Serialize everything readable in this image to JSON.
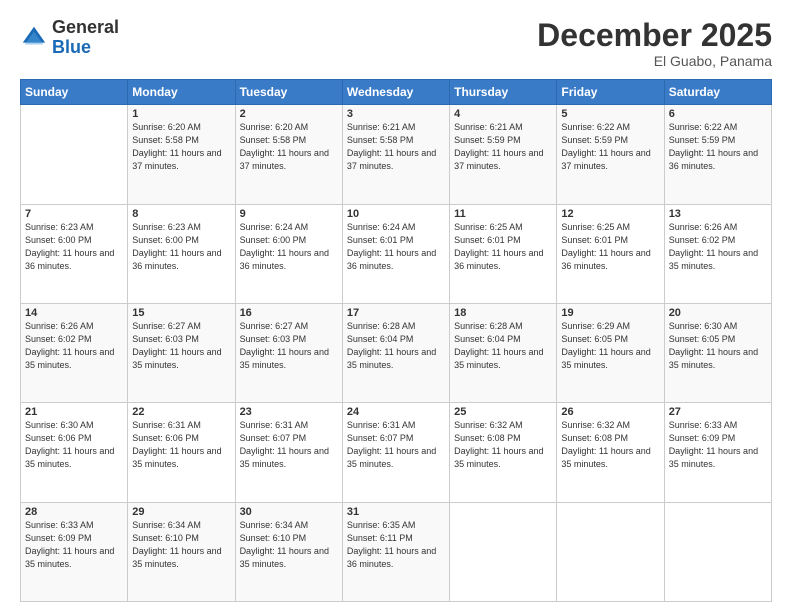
{
  "header": {
    "logo": {
      "general": "General",
      "blue": "Blue"
    },
    "title": "December 2025",
    "subtitle": "El Guabo, Panama"
  },
  "calendar": {
    "weekdays": [
      "Sunday",
      "Monday",
      "Tuesday",
      "Wednesday",
      "Thursday",
      "Friday",
      "Saturday"
    ],
    "weeks": [
      [
        {
          "day": "",
          "info": ""
        },
        {
          "day": "1",
          "info": "Sunrise: 6:20 AM\nSunset: 5:58 PM\nDaylight: 11 hours and 37 minutes."
        },
        {
          "day": "2",
          "info": "Sunrise: 6:20 AM\nSunset: 5:58 PM\nDaylight: 11 hours and 37 minutes."
        },
        {
          "day": "3",
          "info": "Sunrise: 6:21 AM\nSunset: 5:58 PM\nDaylight: 11 hours and 37 minutes."
        },
        {
          "day": "4",
          "info": "Sunrise: 6:21 AM\nSunset: 5:59 PM\nDaylight: 11 hours and 37 minutes."
        },
        {
          "day": "5",
          "info": "Sunrise: 6:22 AM\nSunset: 5:59 PM\nDaylight: 11 hours and 37 minutes."
        },
        {
          "day": "6",
          "info": "Sunrise: 6:22 AM\nSunset: 5:59 PM\nDaylight: 11 hours and 36 minutes."
        }
      ],
      [
        {
          "day": "7",
          "info": "Sunrise: 6:23 AM\nSunset: 6:00 PM\nDaylight: 11 hours and 36 minutes."
        },
        {
          "day": "8",
          "info": "Sunrise: 6:23 AM\nSunset: 6:00 PM\nDaylight: 11 hours and 36 minutes."
        },
        {
          "day": "9",
          "info": "Sunrise: 6:24 AM\nSunset: 6:00 PM\nDaylight: 11 hours and 36 minutes."
        },
        {
          "day": "10",
          "info": "Sunrise: 6:24 AM\nSunset: 6:01 PM\nDaylight: 11 hours and 36 minutes."
        },
        {
          "day": "11",
          "info": "Sunrise: 6:25 AM\nSunset: 6:01 PM\nDaylight: 11 hours and 36 minutes."
        },
        {
          "day": "12",
          "info": "Sunrise: 6:25 AM\nSunset: 6:01 PM\nDaylight: 11 hours and 36 minutes."
        },
        {
          "day": "13",
          "info": "Sunrise: 6:26 AM\nSunset: 6:02 PM\nDaylight: 11 hours and 35 minutes."
        }
      ],
      [
        {
          "day": "14",
          "info": "Sunrise: 6:26 AM\nSunset: 6:02 PM\nDaylight: 11 hours and 35 minutes."
        },
        {
          "day": "15",
          "info": "Sunrise: 6:27 AM\nSunset: 6:03 PM\nDaylight: 11 hours and 35 minutes."
        },
        {
          "day": "16",
          "info": "Sunrise: 6:27 AM\nSunset: 6:03 PM\nDaylight: 11 hours and 35 minutes."
        },
        {
          "day": "17",
          "info": "Sunrise: 6:28 AM\nSunset: 6:04 PM\nDaylight: 11 hours and 35 minutes."
        },
        {
          "day": "18",
          "info": "Sunrise: 6:28 AM\nSunset: 6:04 PM\nDaylight: 11 hours and 35 minutes."
        },
        {
          "day": "19",
          "info": "Sunrise: 6:29 AM\nSunset: 6:05 PM\nDaylight: 11 hours and 35 minutes."
        },
        {
          "day": "20",
          "info": "Sunrise: 6:30 AM\nSunset: 6:05 PM\nDaylight: 11 hours and 35 minutes."
        }
      ],
      [
        {
          "day": "21",
          "info": "Sunrise: 6:30 AM\nSunset: 6:06 PM\nDaylight: 11 hours and 35 minutes."
        },
        {
          "day": "22",
          "info": "Sunrise: 6:31 AM\nSunset: 6:06 PM\nDaylight: 11 hours and 35 minutes."
        },
        {
          "day": "23",
          "info": "Sunrise: 6:31 AM\nSunset: 6:07 PM\nDaylight: 11 hours and 35 minutes."
        },
        {
          "day": "24",
          "info": "Sunrise: 6:31 AM\nSunset: 6:07 PM\nDaylight: 11 hours and 35 minutes."
        },
        {
          "day": "25",
          "info": "Sunrise: 6:32 AM\nSunset: 6:08 PM\nDaylight: 11 hours and 35 minutes."
        },
        {
          "day": "26",
          "info": "Sunrise: 6:32 AM\nSunset: 6:08 PM\nDaylight: 11 hours and 35 minutes."
        },
        {
          "day": "27",
          "info": "Sunrise: 6:33 AM\nSunset: 6:09 PM\nDaylight: 11 hours and 35 minutes."
        }
      ],
      [
        {
          "day": "28",
          "info": "Sunrise: 6:33 AM\nSunset: 6:09 PM\nDaylight: 11 hours and 35 minutes."
        },
        {
          "day": "29",
          "info": "Sunrise: 6:34 AM\nSunset: 6:10 PM\nDaylight: 11 hours and 35 minutes."
        },
        {
          "day": "30",
          "info": "Sunrise: 6:34 AM\nSunset: 6:10 PM\nDaylight: 11 hours and 35 minutes."
        },
        {
          "day": "31",
          "info": "Sunrise: 6:35 AM\nSunset: 6:11 PM\nDaylight: 11 hours and 36 minutes."
        },
        {
          "day": "",
          "info": ""
        },
        {
          "day": "",
          "info": ""
        },
        {
          "day": "",
          "info": ""
        }
      ]
    ]
  }
}
